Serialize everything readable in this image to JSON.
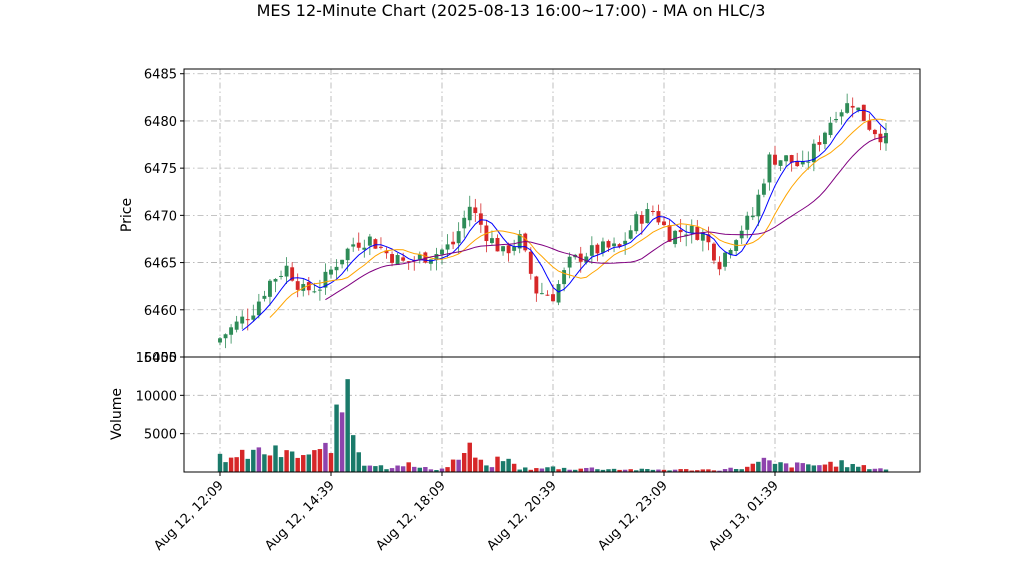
{
  "chart_data": {
    "type": "candlestick",
    "title": "MES 12-Minute Chart (2025-08-13 16:00~17:00) - MA on HLC/3",
    "price_panel": {
      "ylabel": "Price",
      "ylim": [
        6455,
        6485.5
      ],
      "yticks": [
        6455,
        6460,
        6465,
        6470,
        6475,
        6480,
        6485
      ],
      "grid": true
    },
    "volume_panel": {
      "ylabel": "Volume",
      "ylim": [
        0,
        15000
      ],
      "yticks": [
        5000,
        10000,
        15000
      ],
      "grid": true
    },
    "x_tick_labels": [
      "Aug 12, 12:09",
      "Aug 12, 14:39",
      "Aug 12, 18:09",
      "Aug 12, 20:39",
      "Aug 12, 23:09",
      "Aug 13, 01:39"
    ],
    "x_tick_bar_index": [
      0,
      20,
      40,
      60,
      80,
      100
    ],
    "bar_count": 121,
    "up_color": "#2e8b57",
    "down_color": "#d62728",
    "volume_colors": [
      "#1a7a6a",
      "#8e44ad",
      "#d62728"
    ],
    "ma_colors": {
      "fast": "#0000ff",
      "medium": "#ffa500",
      "slow": "#800080"
    },
    "close_anchors": [
      [
        0,
        6457
      ],
      [
        3,
        6458.5
      ],
      [
        6,
        6460
      ],
      [
        9,
        6463
      ],
      [
        12,
        6464.5
      ],
      [
        15,
        6462
      ],
      [
        18,
        6462.5
      ],
      [
        21,
        6465
      ],
      [
        24,
        6467
      ],
      [
        27,
        6467.5
      ],
      [
        30,
        6466
      ],
      [
        33,
        6465
      ],
      [
        36,
        6465.5
      ],
      [
        39,
        6466
      ],
      [
        42,
        6467
      ],
      [
        45,
        6471
      ],
      [
        48,
        6468
      ],
      [
        51,
        6466
      ],
      [
        54,
        6467.5
      ],
      [
        57,
        6462
      ],
      [
        60,
        6461.5
      ],
      [
        63,
        6465
      ],
      [
        66,
        6466
      ],
      [
        69,
        6466.5
      ],
      [
        72,
        6466.5
      ],
      [
        75,
        6469.5
      ],
      [
        78,
        6470.5
      ],
      [
        81,
        6468
      ],
      [
        84,
        6468.5
      ],
      [
        87,
        6468
      ],
      [
        90,
        6465
      ],
      [
        93,
        6468
      ],
      [
        96,
        6470
      ],
      [
        99,
        6476
      ],
      [
        102,
        6476
      ],
      [
        105,
        6475
      ],
      [
        108,
        6478
      ],
      [
        111,
        6481
      ],
      [
        114,
        6482
      ],
      [
        117,
        6479.5
      ],
      [
        120,
        6478
      ]
    ],
    "volume_anchors": [
      [
        0,
        2000
      ],
      [
        3,
        1800
      ],
      [
        6,
        2500
      ],
      [
        9,
        2600
      ],
      [
        12,
        2200
      ],
      [
        15,
        2100
      ],
      [
        18,
        2300
      ],
      [
        20,
        4200
      ],
      [
        22,
        8000
      ],
      [
        23,
        13600
      ],
      [
        24,
        5500
      ],
      [
        26,
        1200
      ],
      [
        30,
        600
      ],
      [
        33,
        1200
      ],
      [
        36,
        500
      ],
      [
        40,
        400
      ],
      [
        45,
        2800
      ],
      [
        48,
        600
      ],
      [
        51,
        1800
      ],
      [
        54,
        500
      ],
      [
        57,
        400
      ],
      [
        60,
        600
      ],
      [
        63,
        400
      ],
      [
        66,
        500
      ],
      [
        70,
        400
      ],
      [
        75,
        300
      ],
      [
        80,
        300
      ],
      [
        85,
        300
      ],
      [
        90,
        300
      ],
      [
        95,
        600
      ],
      [
        98,
        1400
      ],
      [
        100,
        1000
      ],
      [
        104,
        900
      ],
      [
        108,
        900
      ],
      [
        111,
        1200
      ],
      [
        115,
        700
      ],
      [
        120,
        400
      ]
    ],
    "ma_windows": [
      5,
      10,
      20
    ]
  }
}
